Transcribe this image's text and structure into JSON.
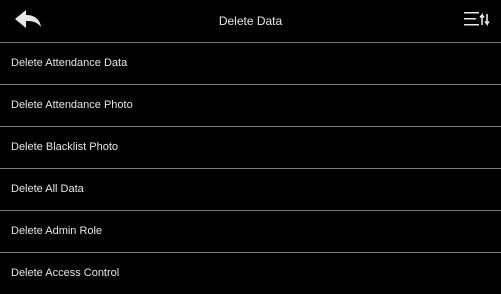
{
  "header": {
    "title": "Delete Data",
    "back_icon": "back-arrow-icon",
    "menu_icon": "sort-menu-icon"
  },
  "items": [
    {
      "label": "Delete Attendance Data"
    },
    {
      "label": "Delete Attendance Photo"
    },
    {
      "label": "Delete Blacklist Photo"
    },
    {
      "label": "Delete All Data"
    },
    {
      "label": "Delete Admin Role"
    },
    {
      "label": "Delete Access Control"
    }
  ],
  "colors": {
    "background": "#000000",
    "divider": "#7a7a7a",
    "text": "#e6e6e6"
  }
}
